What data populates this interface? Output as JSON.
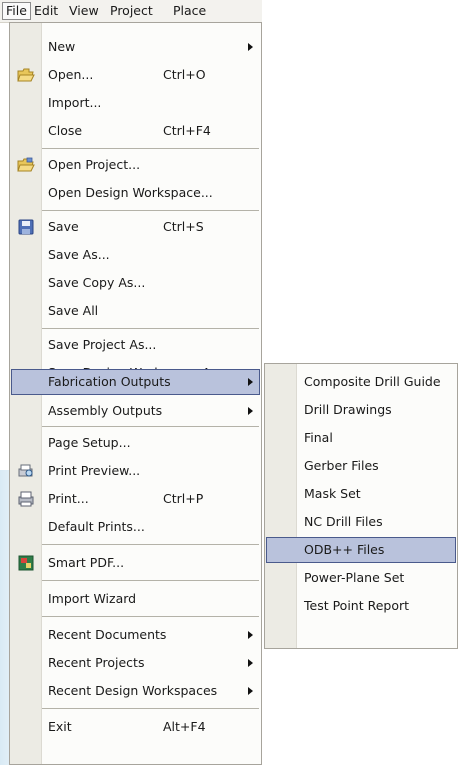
{
  "menubar": {
    "items": [
      "File",
      "Edit",
      "View",
      "Project",
      "Place"
    ]
  },
  "file_menu": {
    "items": [
      {
        "label": "New",
        "submenu": true
      },
      {
        "label": "Open...",
        "shortcut": "Ctrl+O",
        "icon": "open-folder-icon"
      },
      {
        "label": "Import..."
      },
      {
        "label": "Close",
        "shortcut": "Ctrl+F4"
      },
      {
        "label": "Open Project...",
        "icon": "open-project-icon"
      },
      {
        "label": "Open Design Workspace..."
      },
      {
        "label": "Save",
        "shortcut": "Ctrl+S",
        "icon": "save-disk-icon"
      },
      {
        "label": "Save As..."
      },
      {
        "label": "Save Copy As..."
      },
      {
        "label": "Save All"
      },
      {
        "label": "Save Project As..."
      },
      {
        "label": "Save Design Workspace As..."
      },
      {
        "label": "Fabrication Outputs",
        "submenu": true,
        "highlighted": true
      },
      {
        "label": "Assembly Outputs",
        "submenu": true
      },
      {
        "label": "Page Setup..."
      },
      {
        "label": "Print Preview...",
        "icon": "print-preview-icon"
      },
      {
        "label": "Print...",
        "shortcut": "Ctrl+P",
        "icon": "printer-icon"
      },
      {
        "label": "Default Prints..."
      },
      {
        "label": "Smart PDF...",
        "icon": "smart-pdf-icon"
      },
      {
        "label": "Import Wizard"
      },
      {
        "label": "Recent Documents",
        "submenu": true
      },
      {
        "label": "Recent Projects",
        "submenu": true
      },
      {
        "label": "Recent Design Workspaces",
        "submenu": true
      },
      {
        "label": "Exit",
        "shortcut": "Alt+F4"
      }
    ]
  },
  "fabrication_submenu": {
    "items": [
      {
        "label": "Composite Drill Guide"
      },
      {
        "label": "Drill Drawings"
      },
      {
        "label": "Final"
      },
      {
        "label": "Gerber Files"
      },
      {
        "label": "Mask Set"
      },
      {
        "label": "NC Drill Files"
      },
      {
        "label": "ODB++ Files",
        "highlighted": true
      },
      {
        "label": "Power-Plane Set"
      },
      {
        "label": "Test Point Report"
      }
    ]
  },
  "colors": {
    "highlight_fill": "#b9c2dc",
    "highlight_border": "#4a5a8c",
    "gutter": "#ecebe4",
    "menubar": "#f3f2ee"
  }
}
